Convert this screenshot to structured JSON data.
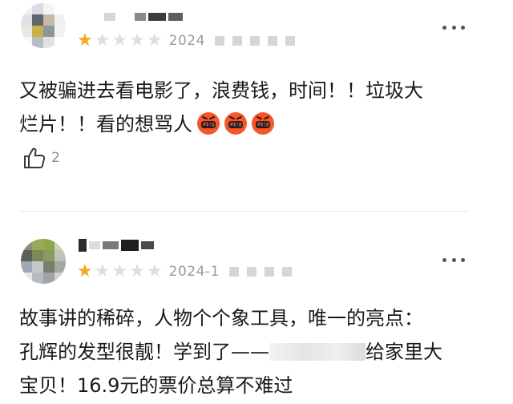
{
  "reviews": [
    {
      "date": "2024",
      "stars": [
        true,
        false,
        false,
        false,
        false
      ],
      "text_lines": [
        "又被骗进去看电影了，浪费钱，时间！！垃圾大",
        "烂片！！看的想骂人"
      ],
      "emoji_icons": [
        "cursing-face-icon",
        "cursing-face-icon",
        "cursing-face-icon"
      ],
      "emoji_mouth_text": "#$!@",
      "likes": "2"
    },
    {
      "date": "2024-1",
      "stars": [
        true,
        false,
        false,
        false,
        false
      ],
      "text_lines": [
        "故事讲的稀碎，人物个个象工具，唯一的亮点：",
        "孔辉的发型很靓！学到了——",
        "给家里大",
        "宝贝！16.9元的票价总算不难过"
      ]
    }
  ],
  "colors": {
    "star_on": "#f5a623",
    "star_off": "#dedede",
    "emoji": "#f5562a",
    "meta_text": "#9a9a9a"
  }
}
